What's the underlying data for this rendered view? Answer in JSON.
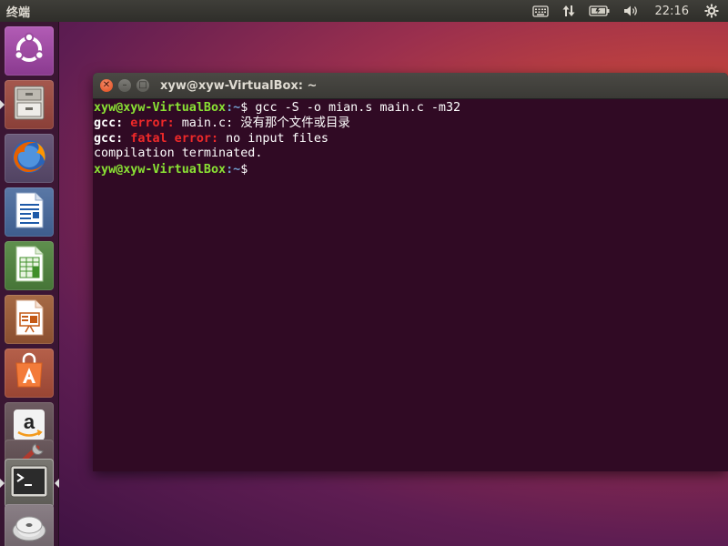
{
  "top_panel": {
    "app_title": "终端",
    "clock": "22:16",
    "indicators": [
      "keyboard-icon",
      "network-transfer-icon",
      "battery-icon",
      "volume-icon",
      "gear-icon"
    ]
  },
  "launcher": {
    "items": [
      {
        "name": "ubuntu-dash",
        "icon": "ubuntu-logo-icon"
      },
      {
        "name": "files",
        "icon": "file-cabinet-icon"
      },
      {
        "name": "firefox",
        "icon": "firefox-icon"
      },
      {
        "name": "writer",
        "icon": "libreoffice-writer-icon"
      },
      {
        "name": "calc",
        "icon": "libreoffice-calc-icon"
      },
      {
        "name": "impress",
        "icon": "libreoffice-impress-icon"
      },
      {
        "name": "software-center",
        "icon": "shopping-bag-icon"
      },
      {
        "name": "amazon",
        "icon": "amazon-icon"
      },
      {
        "name": "system-settings",
        "icon": "wrench-icon"
      },
      {
        "name": "terminal",
        "icon": "terminal-icon"
      },
      {
        "name": "dvd",
        "icon": "disc-icon"
      }
    ]
  },
  "terminal": {
    "title": "xyw@xyw-VirtualBox: ~",
    "lines": [
      {
        "prompt_user": "xyw@xyw-VirtualBox",
        "prompt_path": ":~",
        "prompt_symbol": "$",
        "command": " gcc -S -o mian.s main.c -m32"
      },
      {
        "prefix": "gcc:",
        "level": " error:",
        "message": " main.c: 没有那个文件或目录"
      },
      {
        "prefix": "gcc:",
        "level": " fatal error:",
        "message": " no input files"
      },
      {
        "text": "compilation terminated."
      },
      {
        "prompt_user": "xyw@xyw-VirtualBox",
        "prompt_path": ":~",
        "prompt_symbol": "$",
        "command": ""
      }
    ]
  }
}
